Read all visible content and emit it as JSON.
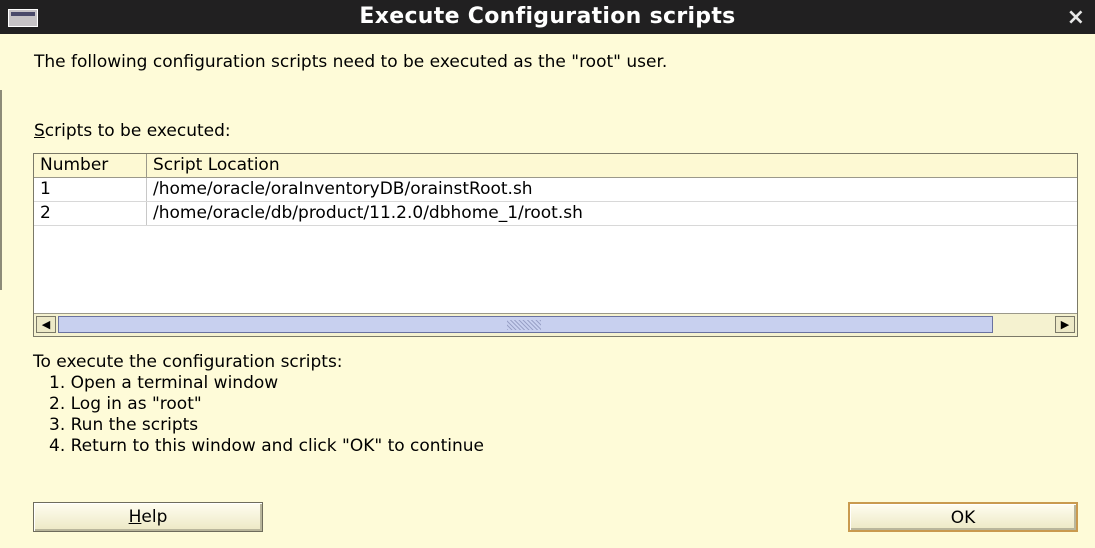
{
  "window": {
    "title": "Execute Configuration scripts",
    "close_glyph": "×"
  },
  "intro_text": "The following configuration scripts need to be executed as the \"root\" user.",
  "scripts_label": {
    "mnemonic": "S",
    "rest": "cripts to be executed:"
  },
  "table": {
    "columns": [
      "Number",
      "Script Location"
    ],
    "rows": [
      {
        "number": "1",
        "location": "/home/oracle/oraInventoryDB/orainstRoot.sh"
      },
      {
        "number": "2",
        "location": "/home/oracle/db/product/11.2.0/dbhome_1/root.sh"
      }
    ]
  },
  "scrollbar": {
    "left_arrow": "◀",
    "right_arrow": "▶"
  },
  "instructions": {
    "heading": "To execute the configuration scripts:",
    "steps": [
      "1. Open a terminal window",
      "2. Log in as \"root\"",
      "3. Run the scripts",
      "4. Return to this window and click \"OK\" to continue"
    ]
  },
  "buttons": {
    "help": {
      "mnemonic": "H",
      "rest": "elp"
    },
    "ok": "OK"
  },
  "colors": {
    "background": "#fefbd8",
    "titlebar": "#212021",
    "scroll_thumb": "#c8d0ef",
    "ok_border": "#c99a4f"
  },
  "icons": [
    "window-menu-icon",
    "close-icon",
    "scroll-left-arrow-icon",
    "scroll-right-arrow-icon"
  ]
}
